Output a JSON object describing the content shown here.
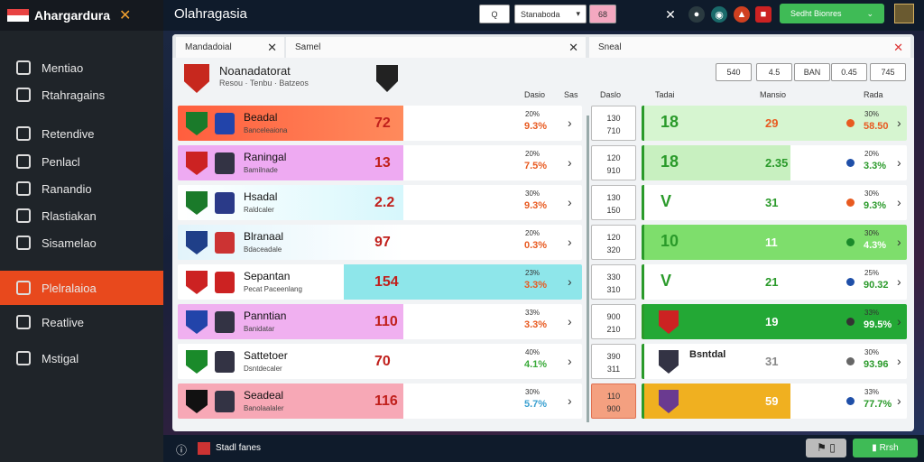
{
  "app": {
    "brand": "Ahargardura",
    "title": "Olahragasia"
  },
  "sidebar": {
    "items": [
      {
        "label": "Mentiao",
        "icon": "shield-icon"
      },
      {
        "label": "Rtahragains",
        "icon": "chart-icon"
      },
      {
        "label": "Retendive",
        "icon": "list-icon"
      },
      {
        "label": "Penlacl",
        "icon": "book-icon"
      },
      {
        "label": "Ranandio",
        "icon": "radio-icon"
      },
      {
        "label": "Rlastiakan",
        "icon": "table-icon"
      },
      {
        "label": "Sisamelao",
        "icon": "shield-icon"
      },
      {
        "label": "Plelralaioa",
        "icon": "trophy-icon",
        "active": true
      },
      {
        "label": "Reatlive",
        "icon": "gear-icon"
      },
      {
        "label": "Mstigal",
        "icon": "globe-icon"
      }
    ]
  },
  "topbar": {
    "search_btn": "Q",
    "select_label": "Stanaboda",
    "badge": "68",
    "green_btn": "Sedht Bionres"
  },
  "tabs": [
    {
      "label": "Mandadoial"
    },
    {
      "label": "Samel"
    },
    {
      "label": "Sneal"
    }
  ],
  "match": {
    "title": "Noanadatorat",
    "subtitle": "Resou · Tenbu · Batzeos",
    "segments": [
      "540",
      "4.5",
      "BAN",
      "0.45",
      "745"
    ]
  },
  "headers": [
    "Dasio",
    "Sas",
    "Daslo",
    "Tadai",
    "Mansio",
    "Rada"
  ],
  "left_rows": [
    {
      "name": "Beadal",
      "sub": "Banceleaiona",
      "score": "72",
      "p1": "20%",
      "p2": "9.3%",
      "accent": "#ff5a3c",
      "fill": "linear-gradient(90deg,#ff5e3e,#ff8a5c)",
      "p2c": "#e85a20",
      "crest": "#1a7a2a",
      "pic": "#2244aa"
    },
    {
      "name": "Raningal",
      "sub": "Bamilnade",
      "score": "13",
      "p1": "20%",
      "p2": "7.5%",
      "accent": "#e8a6ee",
      "fill": "#eeaaf2",
      "p2c": "#e85a20",
      "crest": "#c22",
      "pic": "#334"
    },
    {
      "name": "Hsadal",
      "sub": "Raldcaler",
      "score": "2.2",
      "p1": "30%",
      "p2": "9.3%",
      "accent": "#d0f5fb",
      "fill": "linear-gradient(90deg,#fff,#d6f7fc)",
      "p2c": "#e85a20",
      "crest": "#1a7a2a",
      "pic": "#2a3a88"
    },
    {
      "name": "Blranaal",
      "sub": "Bdaceadale",
      "score": "97",
      "p1": "20%",
      "p2": "0.3%",
      "accent": "#cfeefb",
      "fill": "linear-gradient(90deg,#e2f4fb,#fff)",
      "p2c": "#e85a20",
      "crest": "#1f3f88",
      "pic": "#c33"
    },
    {
      "name": "Sepantan",
      "sub": "Pecat Paceenlang",
      "score": "154",
      "p1": "23%",
      "p2": "3.3%",
      "accent": "#7ee2e6",
      "fill": "#8ee6ea",
      "p2c": "#e85a20",
      "crest": "#c22",
      "pic": "#c22"
    },
    {
      "name": "Panntian",
      "sub": "Banidatar",
      "score": "110",
      "p1": "33%",
      "p2": "3.3%",
      "accent": "#eaa2ec",
      "fill": "#f0b0f0",
      "p2c": "#e85a20",
      "crest": "#2244aa",
      "pic": "#334"
    },
    {
      "name": "Sattetoer",
      "sub": "Dsntdecaler",
      "score": "70",
      "p1": "40%",
      "p2": "4.1%",
      "accent": "#ffffff",
      "fill": "#fff",
      "p2c": "#3aaa3a",
      "crest": "#1a8a2a",
      "pic": "#334"
    },
    {
      "name": "Seadeal",
      "sub": "Banolaalaler",
      "score": "116",
      "p1": "30%",
      "p2": "5.7%",
      "accent": "#f6a0b0",
      "fill": "#f7a8b6",
      "p2c": "#3aa0d0",
      "crest": "#111",
      "pic": "#334"
    }
  ],
  "mid_rows": [
    [
      "130",
      "710"
    ],
    [
      "120",
      "910"
    ],
    [
      "130",
      "150"
    ],
    [
      "120",
      "320"
    ],
    [
      "330",
      "310"
    ],
    [
      "900",
      "210"
    ],
    [
      "390",
      "311"
    ],
    [
      "110",
      "900"
    ]
  ],
  "right_rows": [
    {
      "v1": "18",
      "v2": "29",
      "p1": "30%",
      "p2": "58.50",
      "dot": "#e85a20",
      "fill": "#d6f5d0",
      "v1c": "#2a9a2a",
      "v2c": "#e85a20",
      "p2c": "#e85a20"
    },
    {
      "v1": "18",
      "v2": "2.35",
      "p1": "20%",
      "p2": "3.3%",
      "dot": "#1f4fa8",
      "fill": "#c8f0c0",
      "v1c": "#2a9a2a",
      "v2c": "#2a9a2a",
      "p2c": "#2a9a2a"
    },
    {
      "v1": "V",
      "v2": "31",
      "p1": "30%",
      "p2": "9.3%",
      "dot": "#e85a20",
      "fill": "#fff",
      "v1c": "#2a9a2a",
      "v2c": "#2a9a2a",
      "p2c": "#2a9a2a"
    },
    {
      "v1": "10",
      "v2": "11",
      "p1": "30%",
      "p2": "4.3%",
      "dot": "#1a8a2a",
      "fill": "#7ede6c",
      "v1c": "#2a9a2a",
      "v2c": "#fff",
      "p2c": "#fff"
    },
    {
      "v1": "V",
      "v2": "21",
      "p1": "25%",
      "p2": "90.32",
      "dot": "#1f4fa8",
      "fill": "#fff",
      "v1c": "#2a9a2a",
      "v2c": "#2a9a2a",
      "p2c": "#2a9a2a"
    },
    {
      "v1": "",
      "v2": "19",
      "p1": "33%",
      "p2": "99.5%",
      "dot": "#333",
      "fill": "#23a835",
      "v1c": "#fff",
      "v2c": "#fff",
      "p2c": "#fff"
    },
    {
      "v1": "Bsntdal",
      "v2": "31",
      "p1": "30%",
      "p2": "93.96",
      "dot": "#666",
      "fill": "#fff",
      "v1c": "#222",
      "v2c": "#888",
      "p2c": "#2a9a2a"
    },
    {
      "v1": "",
      "v2": "59",
      "p1": "33%",
      "p2": "77.7%",
      "dot": "#1f4fa8",
      "fill": "#f0b020",
      "v1c": "#fff",
      "v2c": "#fff",
      "p2c": "#2a9a2a"
    }
  ],
  "bottom": {
    "label": "Stadl fanes",
    "btn": "Rrsh"
  }
}
